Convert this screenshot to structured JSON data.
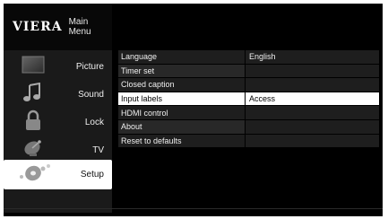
{
  "brand": {
    "logo": "VIERA",
    "title": "Main Menu"
  },
  "nav": [
    {
      "id": "picture",
      "label": "Picture",
      "icon": "picture-icon",
      "selected": false
    },
    {
      "id": "sound",
      "label": "Sound",
      "icon": "music-note-icon",
      "selected": false
    },
    {
      "id": "lock",
      "label": "Lock",
      "icon": "padlock-icon",
      "selected": false
    },
    {
      "id": "tv",
      "label": "TV",
      "icon": "satellite-dish-icon",
      "selected": false
    },
    {
      "id": "setup",
      "label": "Setup",
      "icon": "setup-disc-icon",
      "selected": true
    }
  ],
  "setup_items": [
    {
      "label": "Language",
      "value": "English"
    },
    {
      "label": "Timer set",
      "value": ""
    },
    {
      "label": "Closed caption",
      "value": ""
    },
    {
      "label": "Input labels",
      "value": "Access",
      "selected": true
    },
    {
      "label": "HDMI control",
      "value": ""
    },
    {
      "label": "About",
      "value": ""
    },
    {
      "label": "Reset to defaults",
      "value": ""
    }
  ],
  "colors": {
    "background": "#000000",
    "selected": "#ffffff",
    "row": "#1e1e1e"
  }
}
